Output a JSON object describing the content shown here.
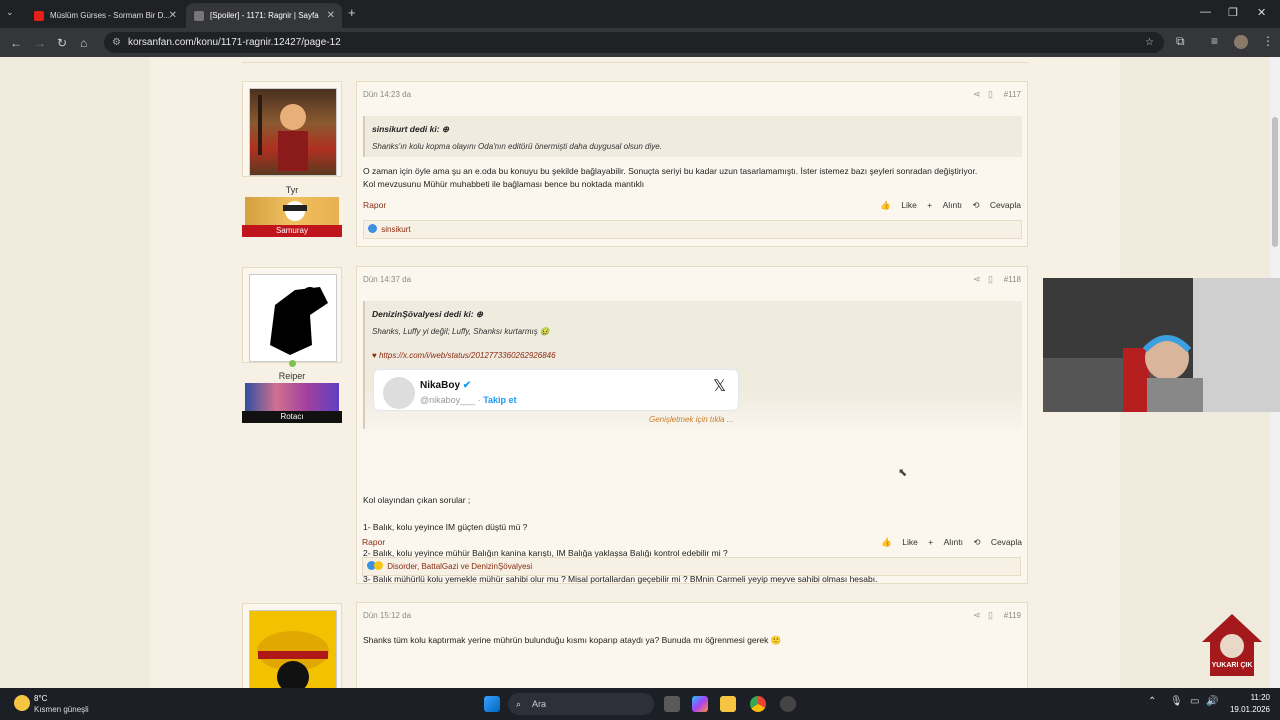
{
  "browser": {
    "tabs": [
      {
        "title": "Müslüm Gürses - Sormam Bir D...",
        "active": false
      },
      {
        "title": "[Spoiler] - 1171: Ragnir | Sayfa",
        "active": true
      }
    ],
    "url": "korsanfan.com/konu/1171-ragnir.12427/page-12",
    "new_tab": "+",
    "minimize": "—",
    "restore": "❐",
    "close": "✕"
  },
  "posts": [
    {
      "user": "Tyr",
      "rank": "Samuray",
      "time": "Dün 14:23 da",
      "number": "#117",
      "quote_author": "sinsikurt dedi ki: ⊕",
      "quote_text": "Shanks'ın kolu kopma olayını Oda'nın editörü önermişti daha duygusal olsun diye.",
      "body": [
        "O zaman için öyle ama şu an e.oda bu konuyu bu şekilde bağlayabilir. Sonuçta seriyi bu kadar uzun tasarlamamıştı. İster istemez bazı şeyleri sonradan değiştiriyor.",
        "Kol mevzusunu Mühür muhabbeti ile bağlaması bence bu noktada mantıklı"
      ],
      "reactions": "sinsikurt"
    },
    {
      "user": "Reiper",
      "rank": "Rotacı",
      "time": "Dün 14:37 da",
      "number": "#118",
      "quote_author": "DenizinŞövalyesi dedi ki: ⊕",
      "quote_text": "Shanks, Luffy yi değil; Luffy, Shanksı kurtarmış 🤢",
      "quote_link": "https://x.com/i/web/status/2012773360262926846",
      "tweet_name": "NikaBoy",
      "tweet_handle": "@nikaboy___ ·",
      "tweet_follow": "Takip et",
      "expand": "Genişletmek için tıkla ...",
      "body": [
        "Kol olayından çıkan sorular ;",
        "1- Balık, kolu yeyince IM güçten düştü mü ?",
        "2- Balık, kolu yeyince mühür Balığın kanina karıştı, IM Balığa yaklaşsa Balığı kontrol edebilir mi ?",
        "3- Balık mühürlü kolu yemekle mühür sahibi olur mu ? Misal portallardan geçebilir mi ? BMnin Carmeli yeyip meyve sahibi olması hesabı."
      ],
      "reactions": "Disorder, BattalGazi ve DenizinŞövalyesi"
    },
    {
      "user": "",
      "time": "Dün 15:12 da",
      "number": "#119",
      "body": [
        "Shanks tüm kolu kaptırmak yerine mührün bulunduğu kısmı koparıp ataydı ya? Bunuda mı öğrenmesi gerek 🙂"
      ]
    }
  ],
  "actions": {
    "report": "Rapor",
    "like": "Like",
    "quote": "Alıntı",
    "reply": "Cevapla"
  },
  "yukari": "YUKARI ÇIK",
  "taskbar": {
    "weather_temp": "8°C",
    "weather_desc": "Kısmen güneşli",
    "search": "Ara",
    "time": "11:20",
    "date": "19.01.2026"
  },
  "colors": {
    "accent": "#8b2b12",
    "samuray": "#c0151c",
    "rotaci": "#111111"
  }
}
